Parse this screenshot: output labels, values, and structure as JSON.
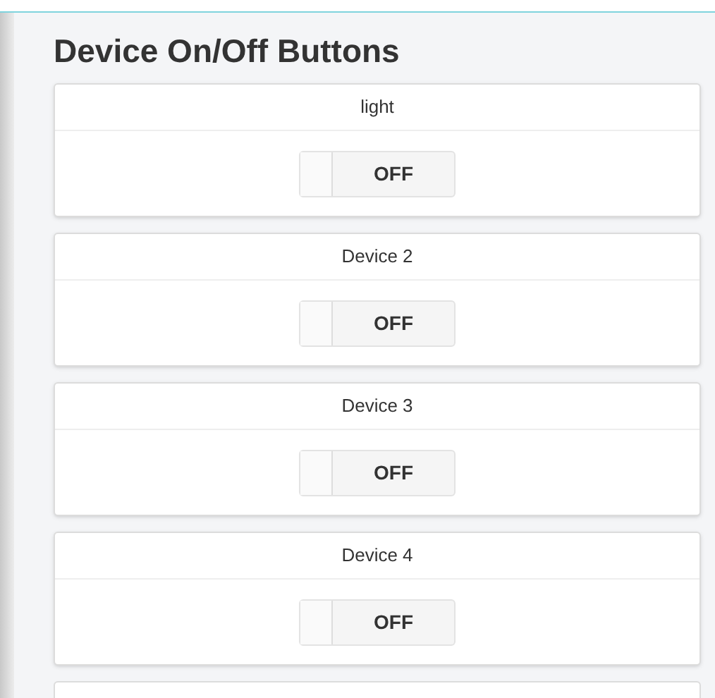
{
  "title": "Device On/Off Buttons",
  "devices": [
    {
      "name": "light",
      "switch_label": "OFF",
      "on": false
    },
    {
      "name": "Device 2",
      "switch_label": "OFF",
      "on": false
    },
    {
      "name": "Device 3",
      "switch_label": "OFF",
      "on": false
    },
    {
      "name": "Device 4",
      "switch_label": "OFF",
      "on": false
    }
  ]
}
